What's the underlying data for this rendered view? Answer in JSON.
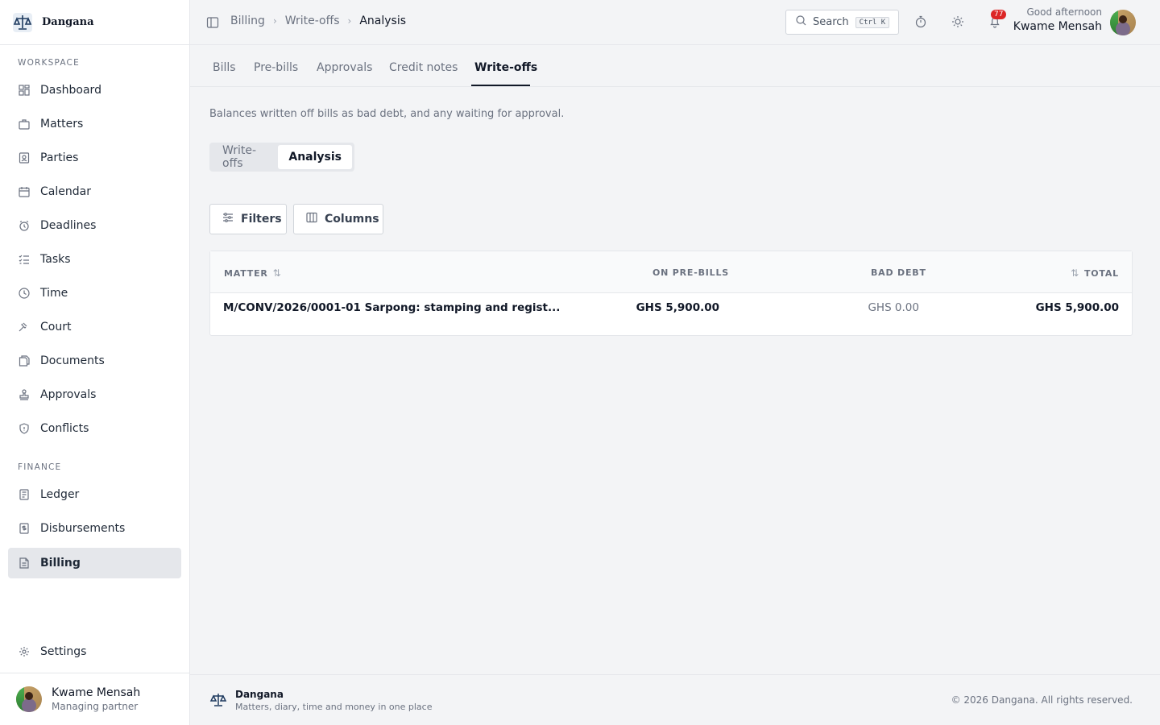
{
  "brand": {
    "name": "Dangana"
  },
  "sidebar": {
    "sections": [
      {
        "title": "WORKSPACE"
      },
      {
        "title": "FINANCE"
      }
    ],
    "workspace_items": [
      {
        "label": "Dashboard",
        "icon": "dashboard-icon"
      },
      {
        "label": "Matters",
        "icon": "briefcase-icon"
      },
      {
        "label": "Parties",
        "icon": "contact-card-icon"
      },
      {
        "label": "Calendar",
        "icon": "calendar-icon"
      },
      {
        "label": "Deadlines",
        "icon": "alarm-clock-icon"
      },
      {
        "label": "Tasks",
        "icon": "task-list-icon"
      },
      {
        "label": "Time",
        "icon": "clock-icon"
      },
      {
        "label": "Court",
        "icon": "gavel-icon"
      },
      {
        "label": "Documents",
        "icon": "documents-icon"
      },
      {
        "label": "Approvals",
        "icon": "stamp-icon"
      },
      {
        "label": "Conflicts",
        "icon": "shield-icon"
      }
    ],
    "finance_items": [
      {
        "label": "Ledger",
        "icon": "ledger-icon"
      },
      {
        "label": "Disbursements",
        "icon": "receipt-icon"
      },
      {
        "label": "Billing",
        "icon": "invoice-icon",
        "active": true
      }
    ],
    "settings": {
      "label": "Settings",
      "icon": "gear-icon"
    },
    "user": {
      "name": "Kwame Mensah",
      "role": "Managing partner"
    }
  },
  "topbar": {
    "breadcrumb": [
      "Billing",
      "Write-offs",
      "Analysis"
    ],
    "search": {
      "label": "Search",
      "shortcut": "Ctrl K"
    },
    "notifications_count": "77",
    "greeting": "Good afternoon",
    "user_name": "Kwame Mensah"
  },
  "tabs": [
    "Bills",
    "Pre-bills",
    "Approvals",
    "Credit notes",
    "Write-offs"
  ],
  "active_tab": "Write-offs",
  "description": "Balances written off bills as bad debt, and any waiting for approval.",
  "segmented": {
    "options": [
      "Write-offs",
      "Analysis"
    ],
    "active": "Analysis"
  },
  "toolbar": {
    "filters_label": "Filters",
    "columns_label": "Columns"
  },
  "table": {
    "headers": {
      "matter": "MATTER",
      "on_pre_bills": "ON PRE-BILLS",
      "bad_debt": "BAD DEBT",
      "total": "TOTAL"
    },
    "rows": [
      {
        "matter": "M/CONV/2026/0001-01 Sarpong: stamping and regist...",
        "on_pre_bills": "GHS 5,900.00",
        "bad_debt": "GHS 0.00",
        "total": "GHS 5,900.00"
      }
    ]
  },
  "footer": {
    "name": "Dangana",
    "tagline": "Matters, diary, time and money in one place",
    "copyright": "© 2026 Dangana. All rights reserved."
  }
}
